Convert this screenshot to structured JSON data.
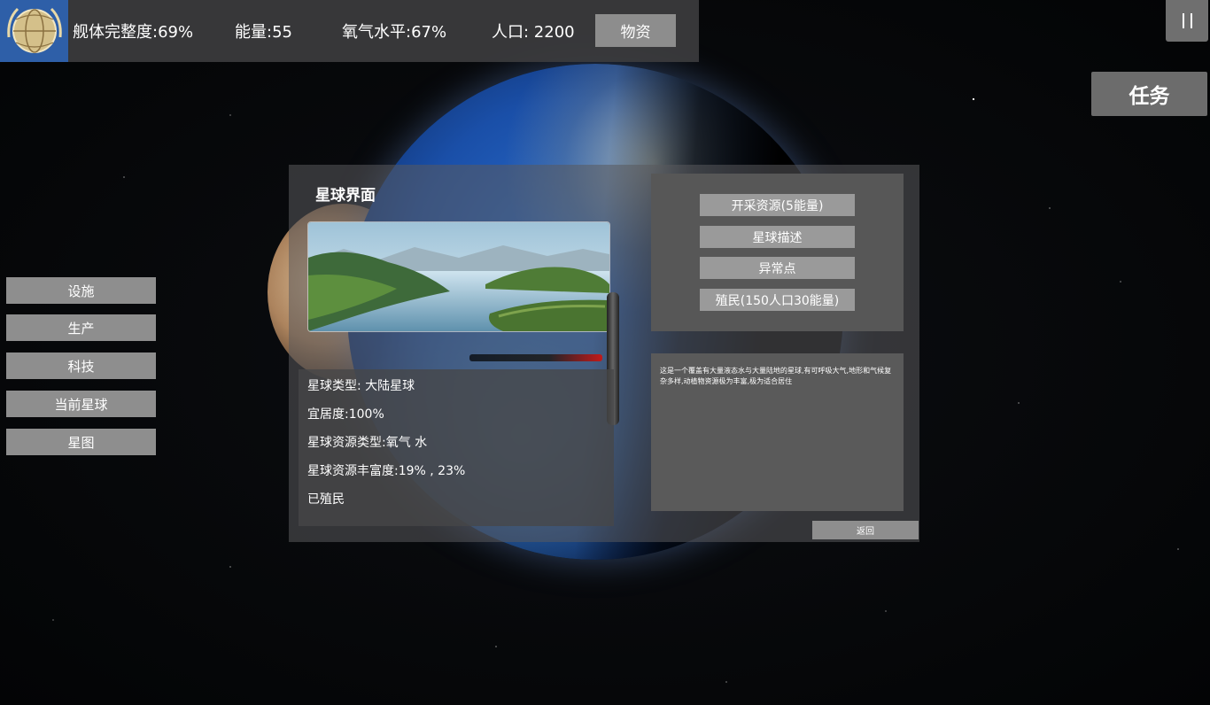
{
  "hud": {
    "hull_integrity": "舰体完整度:69%",
    "energy": "能量:55",
    "oxygen": "氧气水平:67%",
    "population": "人口: 2200",
    "supplies_button": "物资",
    "task_button": "任务"
  },
  "left_menu": [
    {
      "label": "设施"
    },
    {
      "label": "生产"
    },
    {
      "label": "科技"
    },
    {
      "label": "当前星球"
    },
    {
      "label": "星图"
    }
  ],
  "planet_panel": {
    "title": "星球界面",
    "info": {
      "type": "星球类型: 大陆星球",
      "habitability": "宜居度:100%",
      "resource_types": "星球资源类型:氧气 水",
      "resource_richness": "星球资源丰富度:19% , 23%",
      "status": "已殖民"
    },
    "actions": [
      {
        "label": "开采资源(5能量)"
      },
      {
        "label": "星球描述"
      },
      {
        "label": "异常点"
      },
      {
        "label": "殖民(150人口30能量)"
      }
    ],
    "description": "这是一个覆盖有大量液态水与大量陆地的星球,有可呼吸大气,地形和气候复杂多样,动植物资源极为丰富,极为适合居住",
    "return_button": "返回"
  },
  "colors": {
    "hud_bar": "#3c3c3e",
    "button_gray": "#8e8e8e",
    "emblem_blue": "#2e5fa8"
  }
}
